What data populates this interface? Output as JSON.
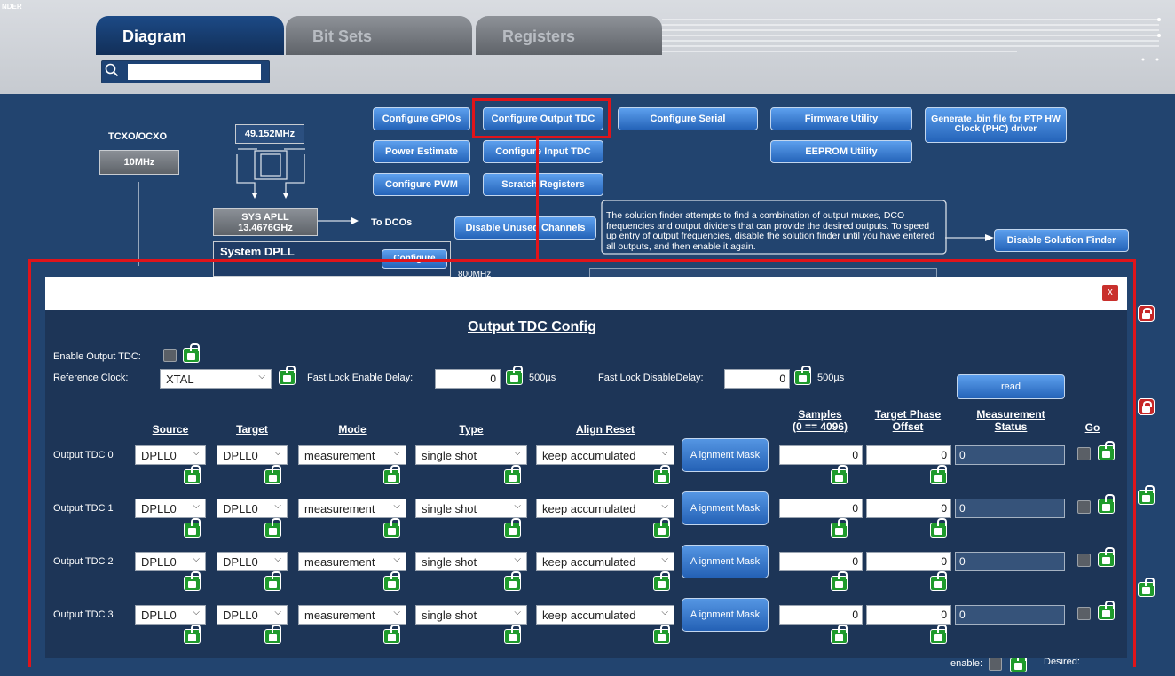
{
  "app": {
    "logo_text": "NDER"
  },
  "tabs": [
    {
      "label": "Diagram"
    },
    {
      "label": "Bit Sets"
    },
    {
      "label": "Registers"
    }
  ],
  "search": {
    "placeholder": ""
  },
  "diagram": {
    "tcxo_label": "TCXO/OCXO",
    "tcxo_value": "10MHz",
    "freq_value": "49.152MHz",
    "sys_apll_line1": "SYS APLL",
    "sys_apll_line2": "13.4676GHz",
    "to_dcos": "To DCOs",
    "system_dpll": "System DPLL",
    "configure_small": "Configure",
    "freq_800": "800MHz",
    "buttons": {
      "configure_gpios": "Configure GPIOs",
      "configure_output_tdc": "Configure Output TDC",
      "configure_serial": "Configure Serial",
      "firmware_utility": "Firmware Utility",
      "generate_bin": "Generate .bin file for PTP HW Clock (PHC) driver",
      "power_estimate": "Power Estimate",
      "configure_input_tdc": "Configure Input TDC",
      "eeprom_utility": "EEPROM Utility",
      "configure_pwm": "Configure PWM",
      "scratch_registers": "Scratch Registers",
      "disable_unused_channels": "Disable Unused Channels",
      "disable_solution_finder": "Disable Solution Finder"
    },
    "solution_text": "The solution finder attempts to find a combination of output muxes, DCO frequencies and output dividers that can provide the desired outputs. To speed up entry of output frequencies, disable the solution finder until you have entered all outputs, and then enable it again.",
    "bottom_enable": "enable:",
    "bottom_desired": "Desired:"
  },
  "dialog": {
    "close_label": "x",
    "title": "Output TDC Config",
    "enable_output_tdc_label": "Enable Output TDC:",
    "reference_clock_label": "Reference Clock:",
    "reference_clock_value": "XTAL",
    "fast_lock_enable_label": "Fast Lock Enable Delay:",
    "fast_lock_enable_value": "0",
    "fast_lock_enable_unit": "500µs",
    "fast_lock_disable_label": "Fast Lock DisableDelay:",
    "fast_lock_disable_value": "0",
    "fast_lock_disable_unit": "500µs",
    "read_label": "read",
    "columns": {
      "source": "Source",
      "target": "Target",
      "mode": "Mode",
      "type": "Type",
      "align_reset": "Align Reset",
      "samples_line1": "Samples",
      "samples_line2": "(0 == 4096)",
      "phase_line1": "Target Phase",
      "phase_line2": "Offset",
      "status_line1": "Measurement",
      "status_line2": "Status",
      "go": "Go"
    },
    "rows": [
      {
        "label": "Output TDC 0",
        "source": "DPLL0",
        "target": "DPLL0",
        "mode": "measurement",
        "type": "single shot",
        "align_reset": "keep accumulated",
        "mask": "Alignment Mask",
        "samples": "0",
        "phase": "0",
        "status": "0"
      },
      {
        "label": "Output TDC 1",
        "source": "DPLL0",
        "target": "DPLL0",
        "mode": "measurement",
        "type": "single shot",
        "align_reset": "keep accumulated",
        "mask": "Alignment Mask",
        "samples": "0",
        "phase": "0",
        "status": "0"
      },
      {
        "label": "Output TDC 2",
        "source": "DPLL0",
        "target": "DPLL0",
        "mode": "measurement",
        "type": "single shot",
        "align_reset": "keep accumulated",
        "mask": "Alignment Mask",
        "samples": "0",
        "phase": "0",
        "status": "0"
      },
      {
        "label": "Output TDC 3",
        "source": "DPLL0",
        "target": "DPLL0",
        "mode": "measurement",
        "type": "single shot",
        "align_reset": "keep accumulated",
        "mask": "Alignment Mask",
        "samples": "0",
        "phase": "0",
        "status": "0"
      }
    ]
  },
  "colors": {
    "highlight": "#e0141a",
    "lock_green": "#1f9a2c",
    "lock_red": "#c62727",
    "dialog_bg": "#1d3557",
    "diagram_bg": "#22446f"
  }
}
